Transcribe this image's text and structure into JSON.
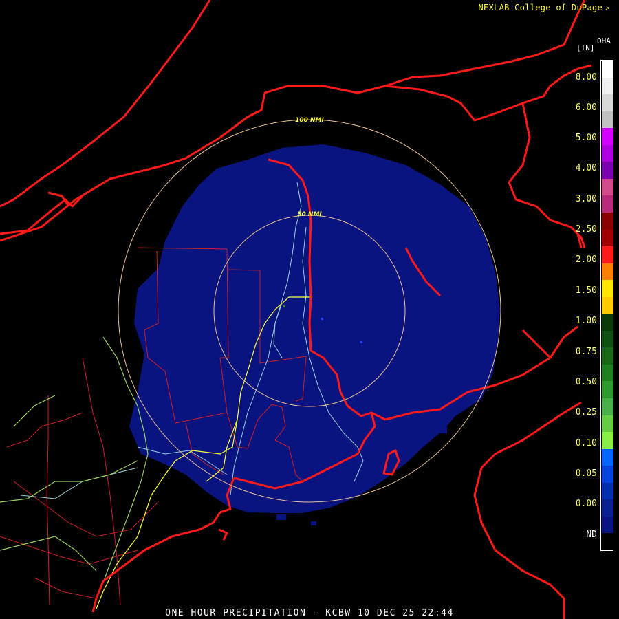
{
  "header": {
    "credit": "NEXLAB-College of DuPage"
  },
  "footer": {
    "caption": "ONE HOUR PRECIPITATION - KCBW 10 DEC 25 22:44"
  },
  "radar": {
    "product_code": "OHA",
    "units": "[IN]",
    "range_rings": [
      "50 NMI",
      "100 NMI"
    ]
  },
  "legend": {
    "labels": [
      "8.00",
      "6.00",
      "5.00",
      "4.00",
      "3.00",
      "2.50",
      "2.00",
      "1.50",
      "1.00",
      "0.75",
      "0.50",
      "0.25",
      "0.10",
      "0.05",
      "0.00",
      "ND"
    ],
    "colors": [
      "#ffffff",
      "#f0f0f0",
      "#d8d8d8",
      "#c0c0c0",
      "#d200ff",
      "#b000e0",
      "#7a00b0",
      "#d24a8a",
      "#b82a7a",
      "#8a0000",
      "#a00000",
      "#ff1a1a",
      "#ff8000",
      "#ffe600",
      "#ffcc00",
      "#0a3a0a",
      "#105010",
      "#186818",
      "#208020",
      "#2e9a2e",
      "#48b048",
      "#66cc44",
      "#88ee44",
      "#0066ff",
      "#0044dd",
      "#0030b0",
      "#082090",
      "#0a1480",
      "#000000"
    ]
  },
  "colors": {
    "precip_fill": "#0a1480",
    "border": "#ff1a1a",
    "county": "#d02020",
    "ring": "#e8c090",
    "river": "#9ad0d8",
    "highway_yellow": "#ffff33",
    "highway_green": "#9ad060"
  }
}
